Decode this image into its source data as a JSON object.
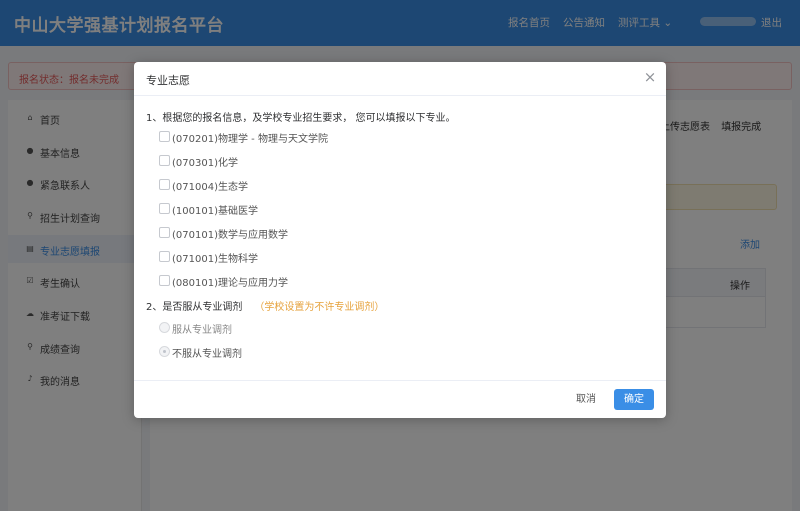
{
  "header": {
    "title": "中山大学强基计划报名平台",
    "nav": [
      "报名首页",
      "公告通知",
      "测评工具 ⌄",
      "退出"
    ]
  },
  "alert": {
    "text": "报名状态：报名未完成"
  },
  "sidebar": {
    "items": [
      {
        "icon": "home-icon",
        "label": "首页"
      },
      {
        "icon": "user-icon",
        "label": "基本信息"
      },
      {
        "icon": "user-icon",
        "label": "紧急联系人"
      },
      {
        "icon": "search-icon",
        "label": "招生计划查询"
      },
      {
        "icon": "document-icon",
        "label": "专业志愿填报"
      },
      {
        "icon": "checkbox-icon",
        "label": "考生确认"
      },
      {
        "icon": "cloud-download-icon",
        "label": "准考证下载"
      },
      {
        "icon": "search-icon",
        "label": "成绩查询"
      },
      {
        "icon": "bell-icon",
        "label": "我的消息"
      }
    ],
    "active_index": 4
  },
  "content": {
    "steps": [
      "上传志愿表",
      "填报完成"
    ],
    "add_label": "添加",
    "table_header_op": "操作"
  },
  "modal": {
    "title": "专业志愿",
    "close": "×",
    "q1": "1、根据您的报名信息，及学校专业招生要求， 您可以填报以下专业。",
    "majors": [
      {
        "label": "(070201)物理学 - 物理与天文学院",
        "checked": false
      },
      {
        "label": "(070301)化学",
        "checked": false
      },
      {
        "label": "(071004)生态学",
        "checked": false
      },
      {
        "label": "(100101)基础医学",
        "checked": false
      },
      {
        "label": "(070101)数学与应用数学",
        "checked": false
      },
      {
        "label": "(071001)生物科学",
        "checked": false
      },
      {
        "label": "(080101)理论与应用力学",
        "checked": false
      }
    ],
    "q2": "2、是否服从专业调剂",
    "q2_note": "（学校设置为不许专业调剂）",
    "adjust_options": [
      {
        "label": "服从专业调剂",
        "checked": false
      },
      {
        "label": "不服从专业调剂",
        "checked": true
      }
    ],
    "cancel_label": "取消",
    "ok_label": "确定"
  },
  "colors": {
    "primary": "#3a8ee6",
    "warning": "#e6a23c",
    "danger": "#e65c5c"
  }
}
